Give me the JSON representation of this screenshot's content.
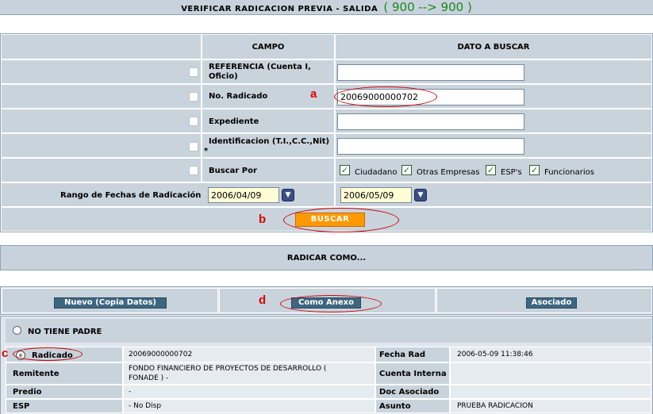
{
  "header": {
    "title": "VERIFICAR RADICACION PREVIA - SALIDA",
    "code": "( 900 --> 900 )"
  },
  "search_form": {
    "col_campo": "CAMPO",
    "col_dato": "DATO A BUSCAR",
    "referencia_label": "REFERENCIA (Cuenta I, Oficio)",
    "referencia_value": "",
    "radicado_label": "No. Radicado",
    "radicado_value": "20069000000702",
    "expediente_label": "Expediente",
    "expediente_value": "",
    "identificacion_label": "Identificacion (T.I.,C.C.,Nit)",
    "identificacion_mark": "*",
    "identificacion_value": "",
    "buscar_por_label": "Buscar Por",
    "buscar_por_options": [
      "Ciudadano",
      "Otras Empresas",
      "ESP's",
      "Funcionarios"
    ],
    "rango_label": "Rango de Fechas de Radicación",
    "fecha_desde": "2006/04/09",
    "fecha_hasta": "2006/05/09",
    "buscar_button": "BUSCAR"
  },
  "radicar": {
    "title": "RADICAR COMO...",
    "nuevo_button": "Nuevo (Copia Datos)",
    "anexo_button": "Como Anexo",
    "asociado_button": "Asociado"
  },
  "results": {
    "no_padre_label": "NO TIENE PADRE",
    "radicado_label": "Radicado",
    "radicado_value": "20069000000702",
    "fecha_rad_label": "Fecha Rad",
    "fecha_rad_value": "2006-05-09 11:38:46",
    "remitente_label": "Remitente",
    "remitente_value": "FONDO FINANCIERO DE PROYECTOS DE DESARROLLO ( FONADE ) -",
    "cuenta_interna_label": "Cuenta Interna",
    "cuenta_interna_value": "",
    "predio_label": "Predio",
    "predio_value": "-",
    "doc_asociado_label": "Doc Asociado",
    "doc_asociado_value": "",
    "esp_label": "ESP",
    "esp_value": "- No Disp",
    "asunto_label": "Asunto",
    "asunto_value": "PRUEBA RADICACION"
  },
  "annotations": {
    "a": "a",
    "b": "b",
    "c": "c",
    "d": "d"
  },
  "colors": {
    "accent_button": "#ff9900",
    "annotation": "#e00000",
    "panel": "#c9d3dc"
  }
}
